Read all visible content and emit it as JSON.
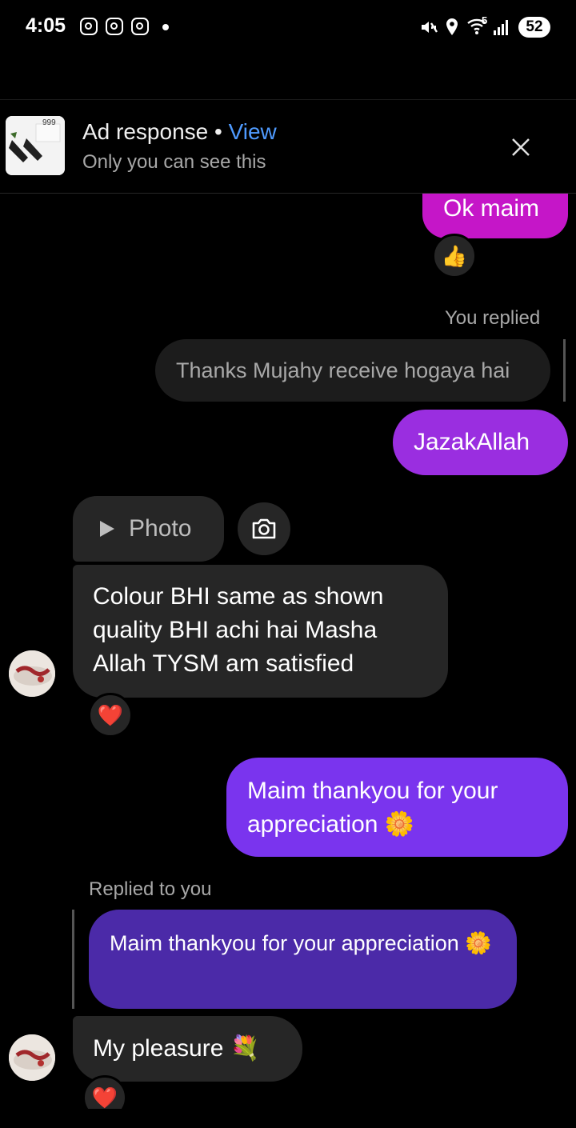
{
  "status_bar": {
    "time": "4:05",
    "notification_icons": [
      "instagram-icon",
      "instagram-icon",
      "instagram-icon"
    ],
    "system_icons": [
      "mute-vibrate-icon",
      "location-icon",
      "wifi-icon",
      "signal-icon"
    ],
    "wifi_band": "5",
    "battery": "52"
  },
  "ad_banner": {
    "title": "Ad response",
    "separator": "•",
    "view_link": "View",
    "subtitle": "Only you can see this",
    "thumb_price": "999"
  },
  "messages": [
    {
      "text": "Ok maim",
      "reaction": "👍"
    },
    {
      "reply_label": "You replied",
      "quoted": "Thanks Mujahy receive hogaya hai",
      "text": "JazakAllah"
    },
    {
      "photo_label": "Photo",
      "text": "Colour BHI same as shown quality BHI achi hai Masha Allah TYSM am satisfied",
      "reaction": "❤️"
    },
    {
      "text": "Maim thankyou for your appreciation 🌼"
    },
    {
      "reply_label": "Replied to you",
      "quoted": "Maim thankyou for your appreciation 🌼",
      "text": "My pleasure 💐",
      "reaction": "❤️"
    }
  ],
  "colors": {
    "outgoing_magenta": "#c516c8",
    "outgoing_purple": "#9a2ee0",
    "outgoing_violet": "#7a34ee",
    "quoted_violet": "#4b2aa8",
    "incoming": "#262626",
    "link_blue": "#4f9bff"
  }
}
